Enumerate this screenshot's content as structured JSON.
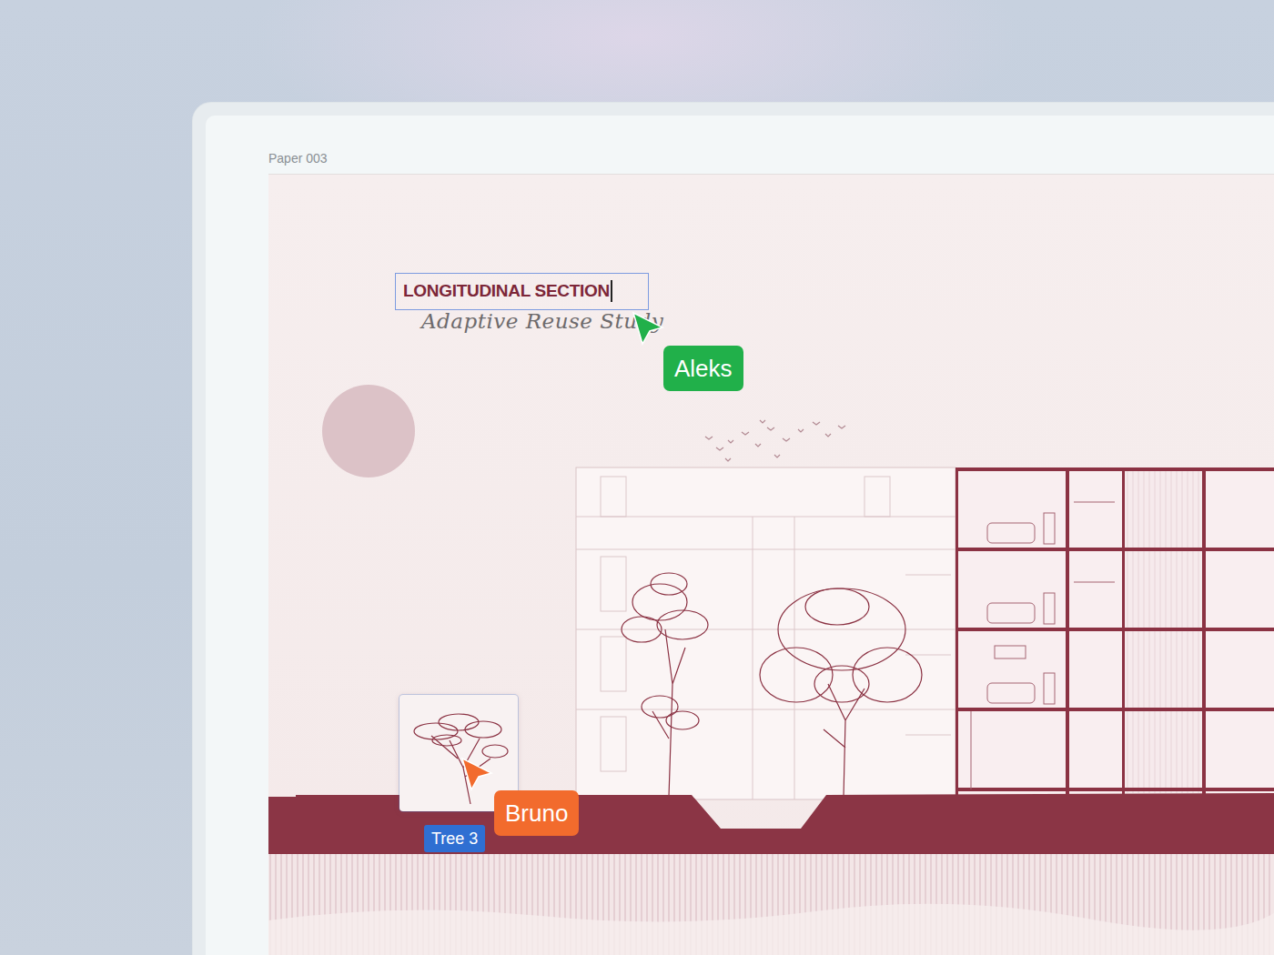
{
  "frame": {
    "label": "Paper 003"
  },
  "title_box": {
    "text": "LONGITUDINAL SECTION",
    "selected": true,
    "editing": true
  },
  "subtitle": "Adaptive Reuse Study",
  "layers": [
    {
      "label": "Tree 3",
      "selected": true
    }
  ],
  "collaborators": [
    {
      "name": "Aleks",
      "color": "#21b04a"
    },
    {
      "name": "Bruno",
      "color": "#f26b2d"
    }
  ]
}
